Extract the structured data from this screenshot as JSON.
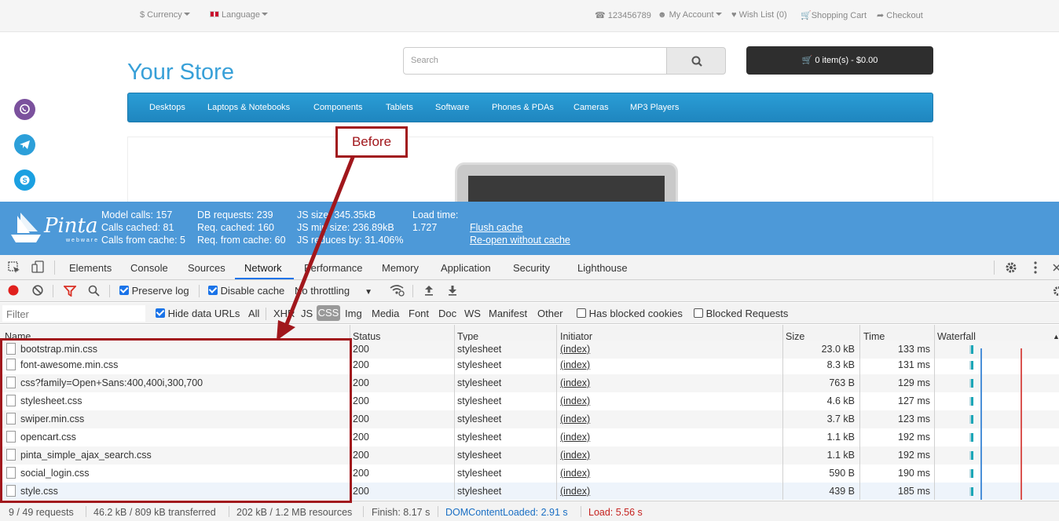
{
  "store": {
    "currency": "$ Currency",
    "language": "Language",
    "phone": "123456789",
    "account": "My Account",
    "wishlist": "Wish List (0)",
    "cart_link": "Shopping Cart",
    "checkout": "Checkout",
    "logo": "Your Store",
    "search_placeholder": "Search",
    "cart_button": "0 item(s) - $0.00",
    "menu": [
      "Desktops",
      "Laptops & Notebooks",
      "Components",
      "Tablets",
      "Software",
      "Phones & PDAs",
      "Cameras",
      "MP3 Players"
    ]
  },
  "pinta": {
    "brand": "Pinta",
    "brand_sub": "webware",
    "model_calls": "Model calls: 157",
    "calls_cached": "Calls cached: 81",
    "calls_from_cache": "Calls from cache: 5",
    "db_requests": "DB requests: 239",
    "req_cached": "Req. cached: 160",
    "req_from_cache": "Req. from cache: 60",
    "js_size": "JS size: 345.35kB",
    "js_min_size": "JS min size: 236.89kB",
    "js_reduces": "JS reduces by: 31.406%",
    "load_time_label": "Load time:",
    "load_time_value": "1.727",
    "flush_cache": "Flush cache",
    "reopen": "Re-open without cache"
  },
  "devtools": {
    "tabs": [
      "Elements",
      "Console",
      "Sources",
      "Network",
      "Performance",
      "Memory",
      "Application",
      "Security",
      "Lighthouse"
    ],
    "active_tab": "Network",
    "preserve_log": "Preserve log",
    "disable_cache": "Disable cache",
    "throttling": "No throttling",
    "filter_placeholder": "Filter",
    "hide_data_urls": "Hide data URLs",
    "types": [
      "All",
      "XHR",
      "JS",
      "CSS",
      "Img",
      "Media",
      "Font",
      "Doc",
      "WS",
      "Manifest",
      "Other"
    ],
    "active_type": "CSS",
    "has_blocked_cookies": "Has blocked cookies",
    "blocked_requests": "Blocked Requests",
    "columns": [
      "Name",
      "Status",
      "Type",
      "Initiator",
      "Size",
      "Time",
      "Waterfall"
    ],
    "partial_row": {
      "name": "bootstrap.min.css",
      "status": "200",
      "type": "stylesheet",
      "initiator": "(index)",
      "size": "23.0 kB",
      "time": "133 ms"
    },
    "rows": [
      {
        "name": "font-awesome.min.css",
        "status": "200",
        "type": "stylesheet",
        "initiator": "(index)",
        "size": "8.3 kB",
        "time": "131 ms"
      },
      {
        "name": "css?family=Open+Sans:400,400i,300,700",
        "status": "200",
        "type": "stylesheet",
        "initiator": "(index)",
        "size": "763 B",
        "time": "129 ms"
      },
      {
        "name": "stylesheet.css",
        "status": "200",
        "type": "stylesheet",
        "initiator": "(index)",
        "size": "4.6 kB",
        "time": "127 ms"
      },
      {
        "name": "swiper.min.css",
        "status": "200",
        "type": "stylesheet",
        "initiator": "(index)",
        "size": "3.7 kB",
        "time": "123 ms"
      },
      {
        "name": "opencart.css",
        "status": "200",
        "type": "stylesheet",
        "initiator": "(index)",
        "size": "1.1 kB",
        "time": "192 ms"
      },
      {
        "name": "pinta_simple_ajax_search.css",
        "status": "200",
        "type": "stylesheet",
        "initiator": "(index)",
        "size": "1.1 kB",
        "time": "192 ms"
      },
      {
        "name": "social_login.css",
        "status": "200",
        "type": "stylesheet",
        "initiator": "(index)",
        "size": "590 B",
        "time": "190 ms"
      },
      {
        "name": "style.css",
        "status": "200",
        "type": "stylesheet",
        "initiator": "(index)",
        "size": "439 B",
        "time": "185 ms"
      }
    ],
    "status_bar": {
      "requests": "9 / 49 requests",
      "transferred": "46.2 kB / 809 kB transferred",
      "resources": "202 kB / 1.2 MB resources",
      "finish": "Finish: 8.17 s",
      "dcl": "DOMContentLoaded: 2.91 s",
      "load": "Load: 5.56 s"
    }
  },
  "annotation": {
    "label": "Before"
  },
  "colors": {
    "accent": "#a1171c",
    "pinta_bar": "#4d99d8",
    "menu": "#2a9dd6",
    "link": "#38a0d8"
  }
}
